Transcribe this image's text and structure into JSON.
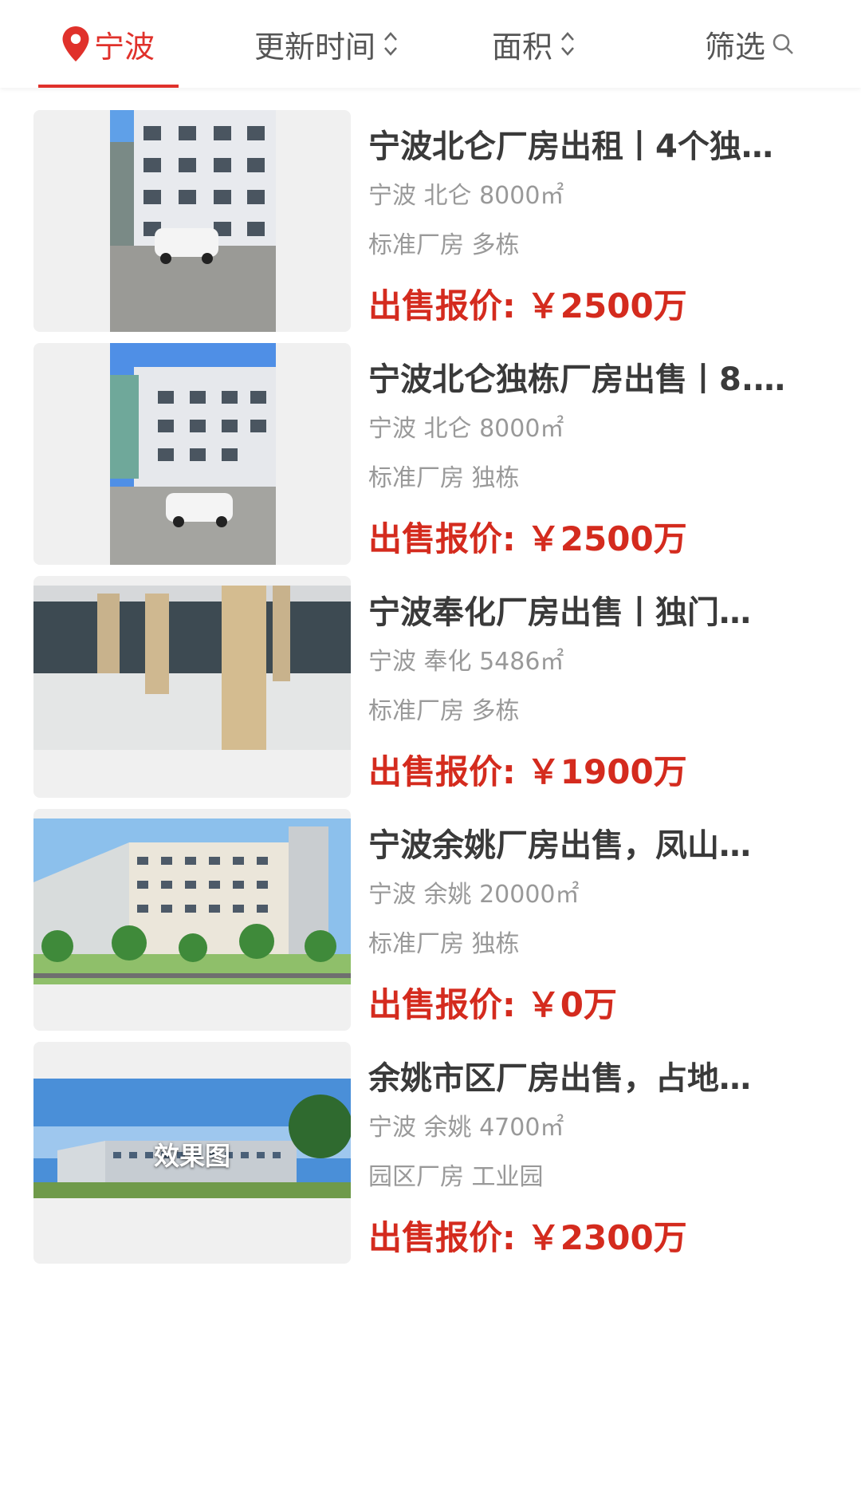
{
  "header": {
    "city": "宁波",
    "tabs": [
      {
        "label": "更新时间"
      },
      {
        "label": "面积"
      },
      {
        "label": "筛选"
      }
    ]
  },
  "listings": [
    {
      "title": "宁波北仑厂房出租丨4个独…",
      "location": "宁波 北仑 8000㎡",
      "tags": "标准厂房 多栋",
      "price_label": "出售报价:",
      "price": "￥2500万"
    },
    {
      "title": "宁波北仑独栋厂房出售丨8.…",
      "location": "宁波 北仑 8000㎡",
      "tags": "标准厂房 独栋",
      "price_label": "出售报价:",
      "price": "￥2500万"
    },
    {
      "title": "宁波奉化厂房出售丨独门…",
      "location": "宁波 奉化 5486㎡",
      "tags": "标准厂房 多栋",
      "price_label": "出售报价:",
      "price": "￥1900万"
    },
    {
      "title": "宁波余姚厂房出售，凤山…",
      "location": "宁波 余姚 20000㎡",
      "tags": "标准厂房 独栋",
      "price_label": "出售报价:",
      "price": "￥0万"
    },
    {
      "title": "余姚市区厂房出售，占地…",
      "location": "宁波 余姚 4700㎡",
      "tags": "园区厂房 工业园",
      "price_label": "出售报价:",
      "price": "￥2300万",
      "image_caption": "效果图"
    }
  ],
  "colors": {
    "accent": "#e0312b",
    "price": "#d42b1e",
    "text": "#3a3a3a",
    "muted": "#999999"
  }
}
